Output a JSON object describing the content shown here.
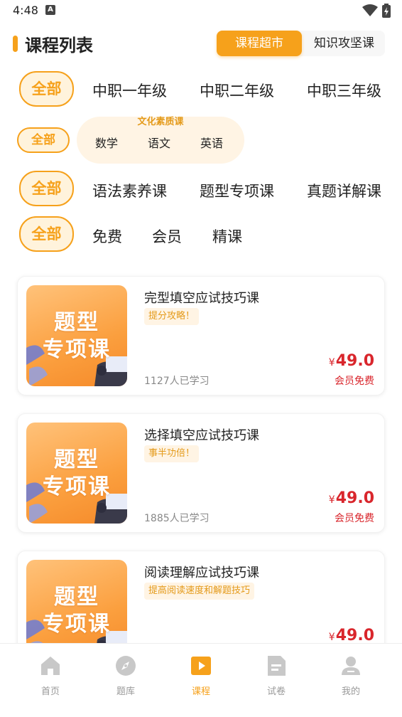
{
  "status_bar": {
    "time": "4:48",
    "indicator": "A"
  },
  "header": {
    "title": "课程列表",
    "segments": [
      {
        "label": "课程超市",
        "active": true
      },
      {
        "label": "知识攻坚课",
        "active": false
      }
    ]
  },
  "filters": {
    "grade": {
      "all_label": "全部",
      "options": [
        "中职一年级",
        "中职二年级",
        "中职三年级"
      ]
    },
    "subject": {
      "all_label": "全部",
      "group_label": "文化素质课",
      "options": [
        "数学",
        "语文",
        "英语"
      ]
    },
    "course_type": {
      "all_label": "全部",
      "options": [
        "语法素养课",
        "题型专项课",
        "真题详解课"
      ]
    },
    "price_type": {
      "all_label": "全部",
      "options": [
        "免费",
        "会员",
        "精课"
      ]
    }
  },
  "courses": [
    {
      "title": "完型填空应试技巧课",
      "tag": "提分攻略！",
      "learners": "1127人已学习",
      "currency": "¥",
      "price": "49.0",
      "member_note": "会员免费",
      "cover_text_1": "题型",
      "cover_text_2": "专项课"
    },
    {
      "title": "选择填空应试技巧课",
      "tag": "事半功倍！",
      "learners": "1885人已学习",
      "currency": "¥",
      "price": "49.0",
      "member_note": "会员免费",
      "cover_text_1": "题型",
      "cover_text_2": "专项课"
    },
    {
      "title": "阅读理解应试技巧课",
      "tag": "提高阅读速度和解题技巧",
      "learners": "",
      "currency": "¥",
      "price": "49.0",
      "member_note": "",
      "cover_text_1": "题型",
      "cover_text_2": "专项课"
    }
  ],
  "tabbar": {
    "items": [
      {
        "label": "首页",
        "icon": "home-icon",
        "active": false
      },
      {
        "label": "题库",
        "icon": "compass-icon",
        "active": false
      },
      {
        "label": "课程",
        "icon": "play-icon",
        "active": true
      },
      {
        "label": "试卷",
        "icon": "document-icon",
        "active": false
      },
      {
        "label": "我的",
        "icon": "profile-icon",
        "active": false
      }
    ]
  },
  "colors": {
    "accent": "#f6a11b",
    "accent_light": "#fff3dc",
    "price": "#d9262c",
    "muted": "#999999"
  }
}
